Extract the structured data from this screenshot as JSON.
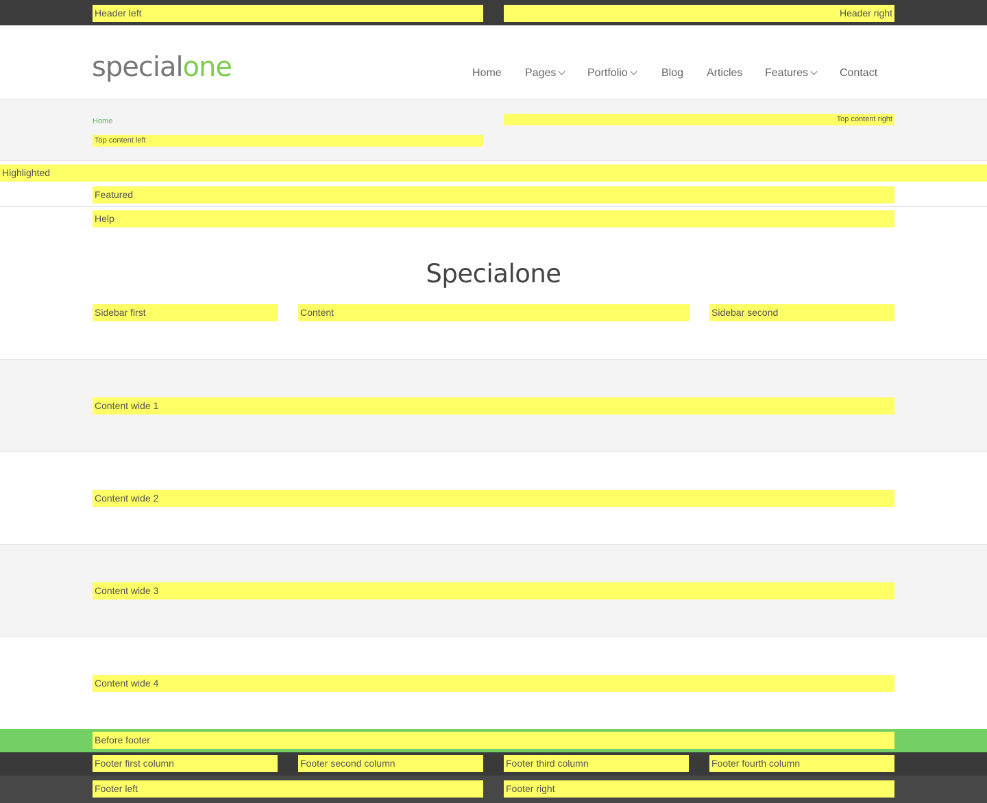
{
  "header_top": {
    "left": "Header left",
    "right": "Header right"
  },
  "site": {
    "logo_part1": "special",
    "logo_part2": "one"
  },
  "nav": {
    "items": [
      {
        "label": "Home"
      },
      {
        "label": "Pages"
      },
      {
        "label": "Portfolio"
      },
      {
        "label": "Blog"
      },
      {
        "label": "Articles"
      },
      {
        "label": "Features"
      },
      {
        "label": "Contact"
      }
    ]
  },
  "top_content": {
    "breadcrumb": "Home",
    "left": "Top content left",
    "right": "Top content right"
  },
  "regions": {
    "highlighted": "Highlighted",
    "featured": "Featured",
    "help": "Help",
    "sidebar_first": "Sidebar first",
    "content": "Content",
    "sidebar_second": "Sidebar second",
    "content_wide_1": "Content wide 1",
    "content_wide_2": "Content wide 2",
    "content_wide_3": "Content wide 3",
    "content_wide_4": "Content wide 4",
    "before_footer": "Before footer"
  },
  "page": {
    "title": "Specialone"
  },
  "footer": {
    "first": "Footer first column",
    "second": "Footer second column",
    "third": "Footer third column",
    "fourth": "Footer fourth column",
    "left": "Footer left",
    "right": "Footer right"
  },
  "colors": {
    "accent": "#7dcd4d",
    "region_highlight": "#ffff66",
    "before_footer_bg": "#74d064",
    "dark_bar": "#3c3c3c"
  }
}
